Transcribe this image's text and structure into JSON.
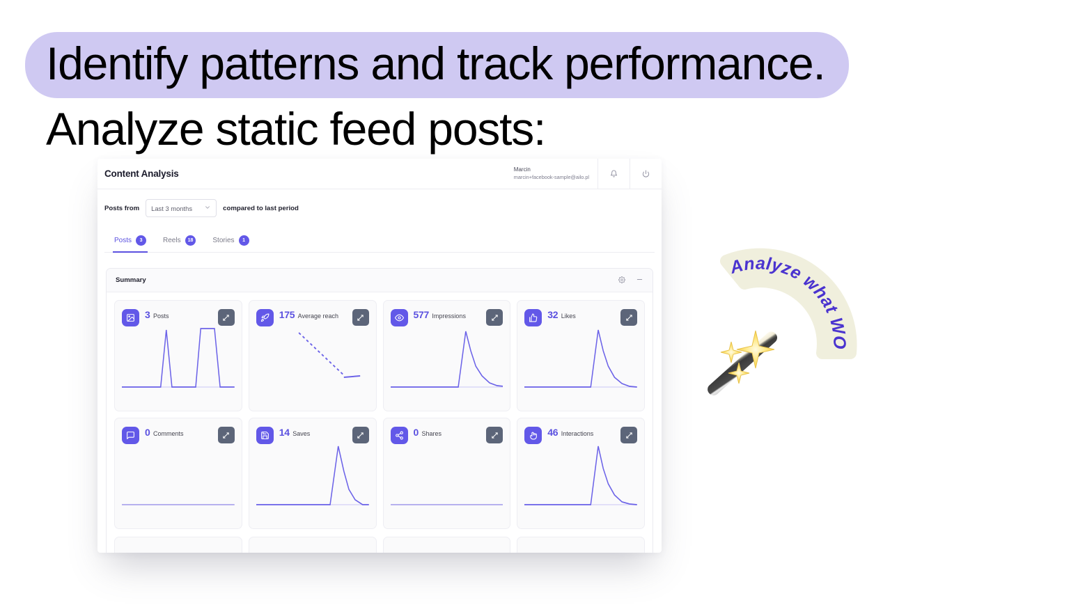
{
  "headline": {
    "line1": "Identify patterns and track performance.",
    "line2": "Analyze static feed posts:",
    "highlight_color": "#cfc9f2"
  },
  "dashboard": {
    "header": {
      "title": "Content Analysis",
      "user_name": "Marcin",
      "user_email": "marcin+facebook-sample@ailo.pl",
      "notifications_icon": "bell-icon",
      "logout_icon": "power-icon"
    },
    "filters": {
      "label": "Posts from",
      "select_value": "Last 3 months",
      "select_options": [
        "Last 3 months"
      ],
      "note": "compared to last period"
    },
    "tabs": [
      {
        "label": "Posts",
        "badge": "3",
        "active": true
      },
      {
        "label": "Reels",
        "badge": "18",
        "active": false
      },
      {
        "label": "Stories",
        "badge": "1",
        "active": false
      }
    ],
    "summary": {
      "title": "Summary",
      "settings_icon": "gear-icon",
      "collapse_icon": "minus-icon"
    },
    "metrics": [
      {
        "value": "3",
        "label": "Posts",
        "icon": "image-icon"
      },
      {
        "value": "175",
        "label": "Average reach",
        "icon": "rocket-icon"
      },
      {
        "value": "577",
        "label": "Impressions",
        "icon": "eye-icon"
      },
      {
        "value": "32",
        "label": "Likes",
        "icon": "thumbs-up-icon"
      },
      {
        "value": "0",
        "label": "Comments",
        "icon": "comment-icon"
      },
      {
        "value": "14",
        "label": "Saves",
        "icon": "save-icon"
      },
      {
        "value": "0",
        "label": "Shares",
        "icon": "share-icon"
      },
      {
        "value": "46",
        "label": "Interactions",
        "icon": "tap-icon"
      }
    ],
    "accent_color": "#6258e8",
    "expand_button_color": "#5c6579"
  },
  "badge": {
    "text": "Analyze what WORKS",
    "text_color": "#4a33cf",
    "arc_color": "#f0efdd",
    "wand_icon": "magic-wand-icon"
  },
  "chart_data": [
    {
      "type": "line",
      "title": "Posts",
      "ylabel": "",
      "x": [
        0,
        1,
        2,
        3,
        4,
        5,
        6,
        7,
        8,
        9,
        10,
        11,
        12,
        13,
        14,
        15,
        16
      ],
      "values": [
        0,
        0,
        0,
        0,
        0,
        0,
        0,
        100,
        0,
        0,
        0,
        100,
        100,
        0,
        0,
        0,
        0
      ],
      "grid": false
    },
    {
      "type": "line",
      "title": "Average reach",
      "x": [
        0,
        1,
        2,
        3,
        4,
        5,
        6,
        7,
        8,
        9,
        10
      ],
      "values": [
        100,
        92,
        84,
        75,
        66,
        57,
        48,
        38,
        28,
        18,
        16
      ],
      "style": "dashed",
      "grid": false
    },
    {
      "type": "line",
      "title": "Impressions",
      "x": [
        0,
        1,
        2,
        3,
        4,
        5,
        6,
        7,
        8,
        9,
        10,
        11,
        12,
        13,
        14,
        15,
        16
      ],
      "values": [
        0,
        0,
        0,
        0,
        0,
        0,
        0,
        0,
        0,
        0,
        100,
        60,
        34,
        20,
        12,
        7,
        4
      ],
      "grid": false
    },
    {
      "type": "line",
      "title": "Likes",
      "x": [
        0,
        1,
        2,
        3,
        4,
        5,
        6,
        7,
        8,
        9,
        10,
        11,
        12,
        13,
        14,
        15,
        16
      ],
      "values": [
        0,
        0,
        0,
        0,
        0,
        0,
        0,
        0,
        0,
        0,
        0,
        100,
        58,
        30,
        16,
        8,
        3
      ],
      "grid": false
    },
    {
      "type": "line",
      "title": "Comments",
      "x": [
        0,
        1,
        2,
        3,
        4,
        5,
        6,
        7,
        8,
        9,
        10,
        11,
        12,
        13,
        14,
        15,
        16
      ],
      "values": [
        0,
        0,
        0,
        0,
        0,
        0,
        0,
        0,
        0,
        0,
        0,
        0,
        0,
        0,
        0,
        0,
        0
      ],
      "grid": false
    },
    {
      "type": "line",
      "title": "Saves",
      "x": [
        0,
        1,
        2,
        3,
        4,
        5,
        6,
        7,
        8,
        9,
        10,
        11,
        12,
        13,
        14,
        15,
        16
      ],
      "values": [
        0,
        0,
        0,
        0,
        0,
        0,
        0,
        0,
        0,
        0,
        0,
        0,
        100,
        55,
        22,
        6,
        0
      ],
      "grid": false
    },
    {
      "type": "line",
      "title": "Shares",
      "x": [
        0,
        1,
        2,
        3,
        4,
        5,
        6,
        7,
        8,
        9,
        10,
        11,
        12,
        13,
        14,
        15,
        16
      ],
      "values": [
        0,
        0,
        0,
        0,
        0,
        0,
        0,
        0,
        0,
        0,
        0,
        0,
        0,
        0,
        0,
        0,
        0
      ],
      "grid": false
    },
    {
      "type": "line",
      "title": "Interactions",
      "x": [
        0,
        1,
        2,
        3,
        4,
        5,
        6,
        7,
        8,
        9,
        10,
        11,
        12,
        13,
        14,
        15,
        16
      ],
      "values": [
        0,
        0,
        0,
        0,
        0,
        0,
        0,
        0,
        0,
        0,
        0,
        100,
        62,
        32,
        16,
        7,
        2
      ],
      "grid": false
    }
  ]
}
